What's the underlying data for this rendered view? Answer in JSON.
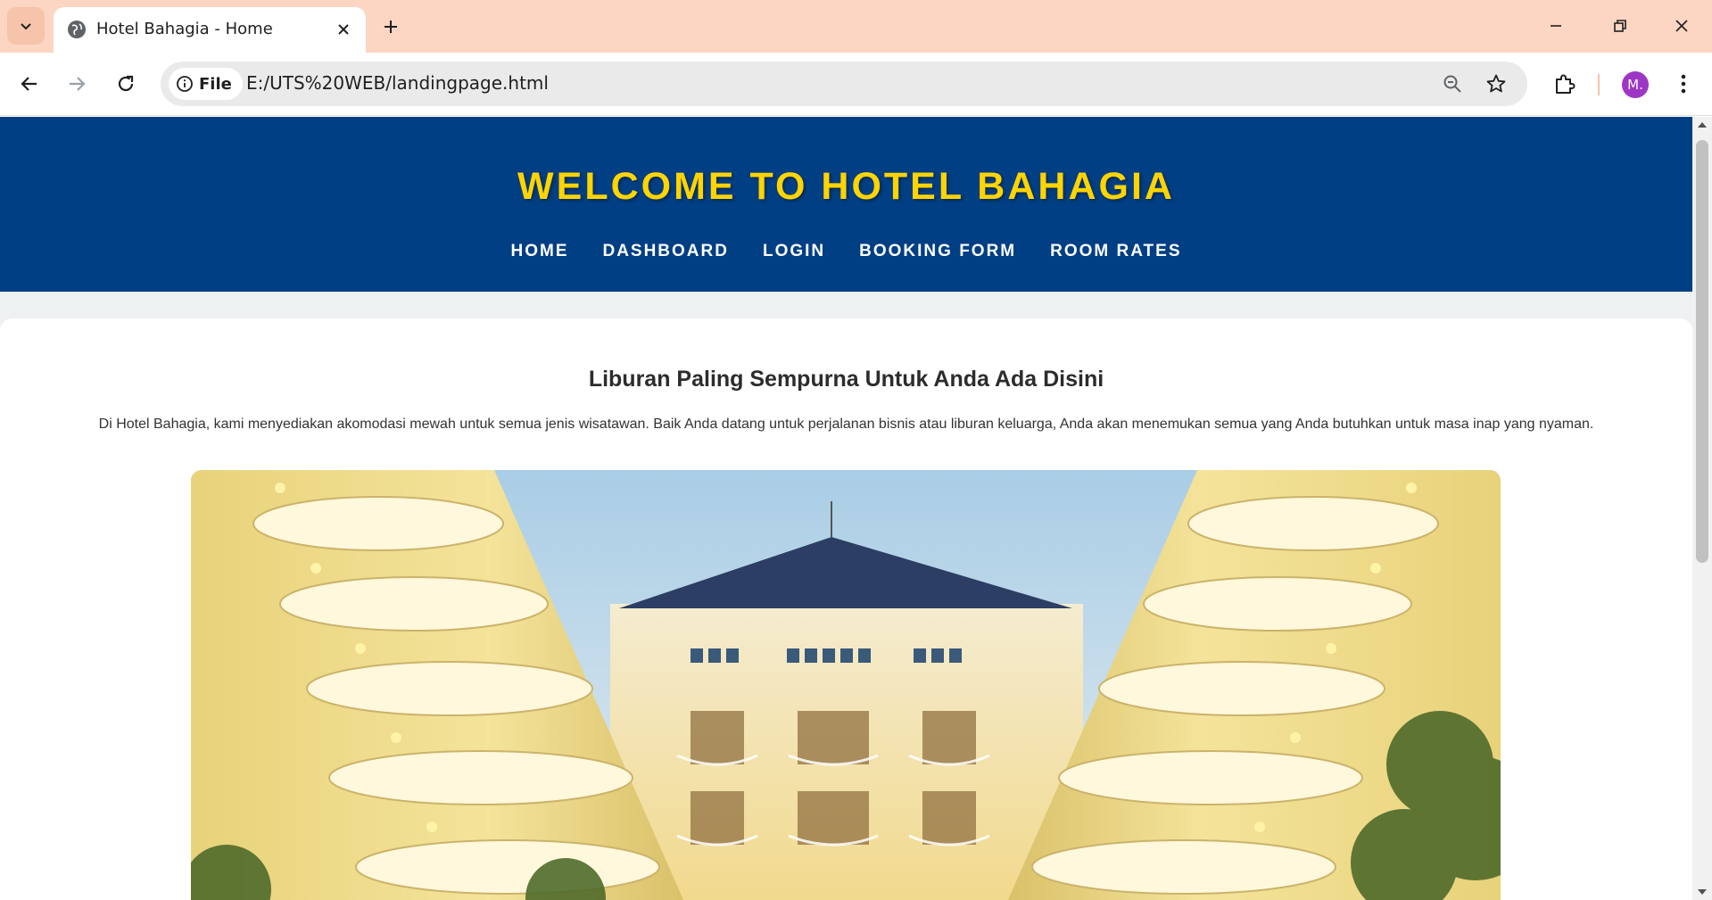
{
  "browser": {
    "tab_title": "Hotel Bahagia - Home",
    "site_chip": "File",
    "url": "E:/UTS%20WEB/landingpage.html",
    "avatar_letter": "M.",
    "avatar_color": "#9c36c4",
    "tabbar_color": "#fcd6c3"
  },
  "site": {
    "title": "WELCOME TO HOTEL BAHAGIA",
    "title_color": "#ffd400",
    "header_color": "#003f84",
    "nav": [
      "HOME",
      "DASHBOARD",
      "LOGIN",
      "BOOKING FORM",
      "ROOM RATES"
    ]
  },
  "content": {
    "heading": "Liburan Paling Sempurna Untuk Anda Ada Disini",
    "paragraph": "Di Hotel Bahagia, kami menyediakan akomodasi mewah untuk semua jenis wisatawan. Baik Anda datang untuk perjalanan bisnis atau liburan keluarga, Anda akan menemukan semua yang Anda butuhkan untuk masa inap yang nyaman."
  }
}
